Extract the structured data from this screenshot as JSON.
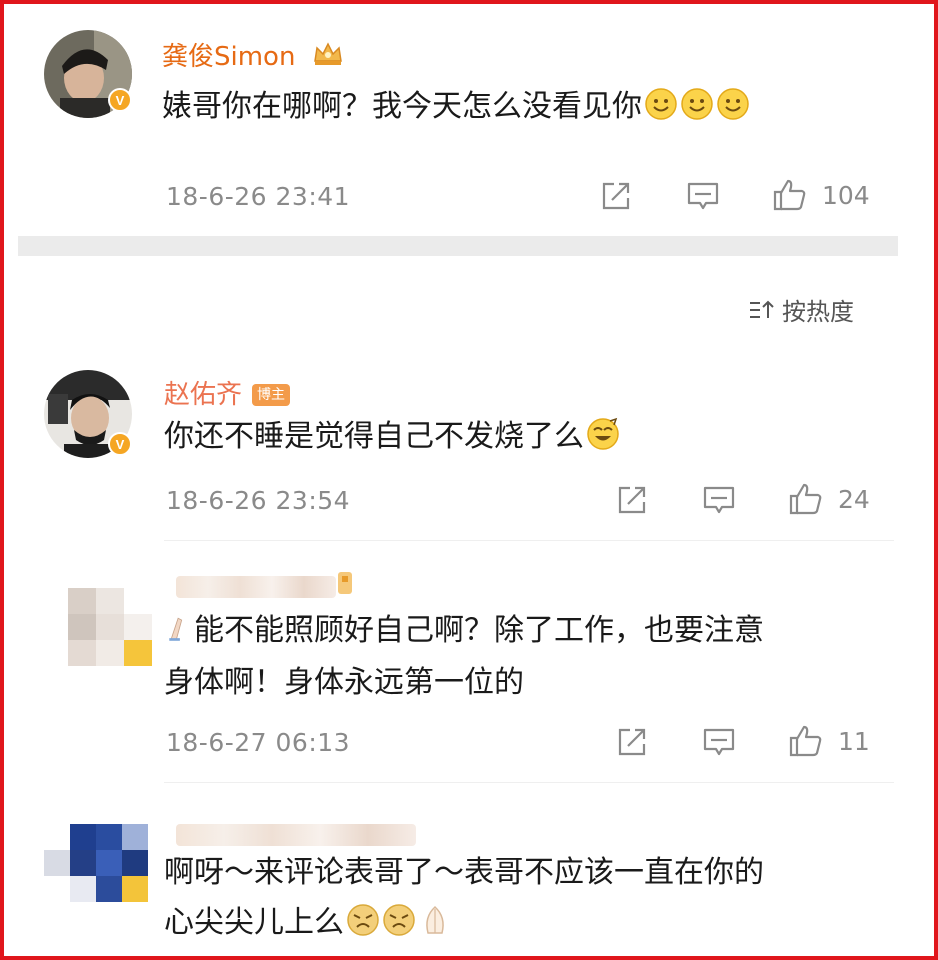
{
  "comments": [
    {
      "username": "龚俊Simon",
      "text": "婊哥你在哪啊？我今天怎么没看见你",
      "time": "18-6-26 23:41",
      "likes": "104"
    },
    {
      "username": "赵佑齐",
      "badge": "博主",
      "text": "你还不睡是觉得自己不发烧了么",
      "time": "18-6-26 23:54",
      "likes": "24"
    },
    {
      "username": "",
      "text_line1": "能不能照顾好自己啊？除了工作，也要注意",
      "text_line2": "身体啊！身体永远第一位的",
      "time": "18-6-27 06:13",
      "likes": "11"
    },
    {
      "username": "",
      "text_line1": "啊呀～来评论表哥了～表哥不应该一直在你的",
      "text_line2": "心尖尖儿上么"
    }
  ],
  "sort": {
    "label": "按热度"
  },
  "icons": {
    "share": "share-icon",
    "comment": "comment-icon",
    "like": "thumbs-up-icon",
    "emoji": "smile-emoji-icon"
  },
  "colors": {
    "border": "#e0161c",
    "username": "#e66a14",
    "meta": "#8a8a8a",
    "verified": "#f5a623"
  }
}
